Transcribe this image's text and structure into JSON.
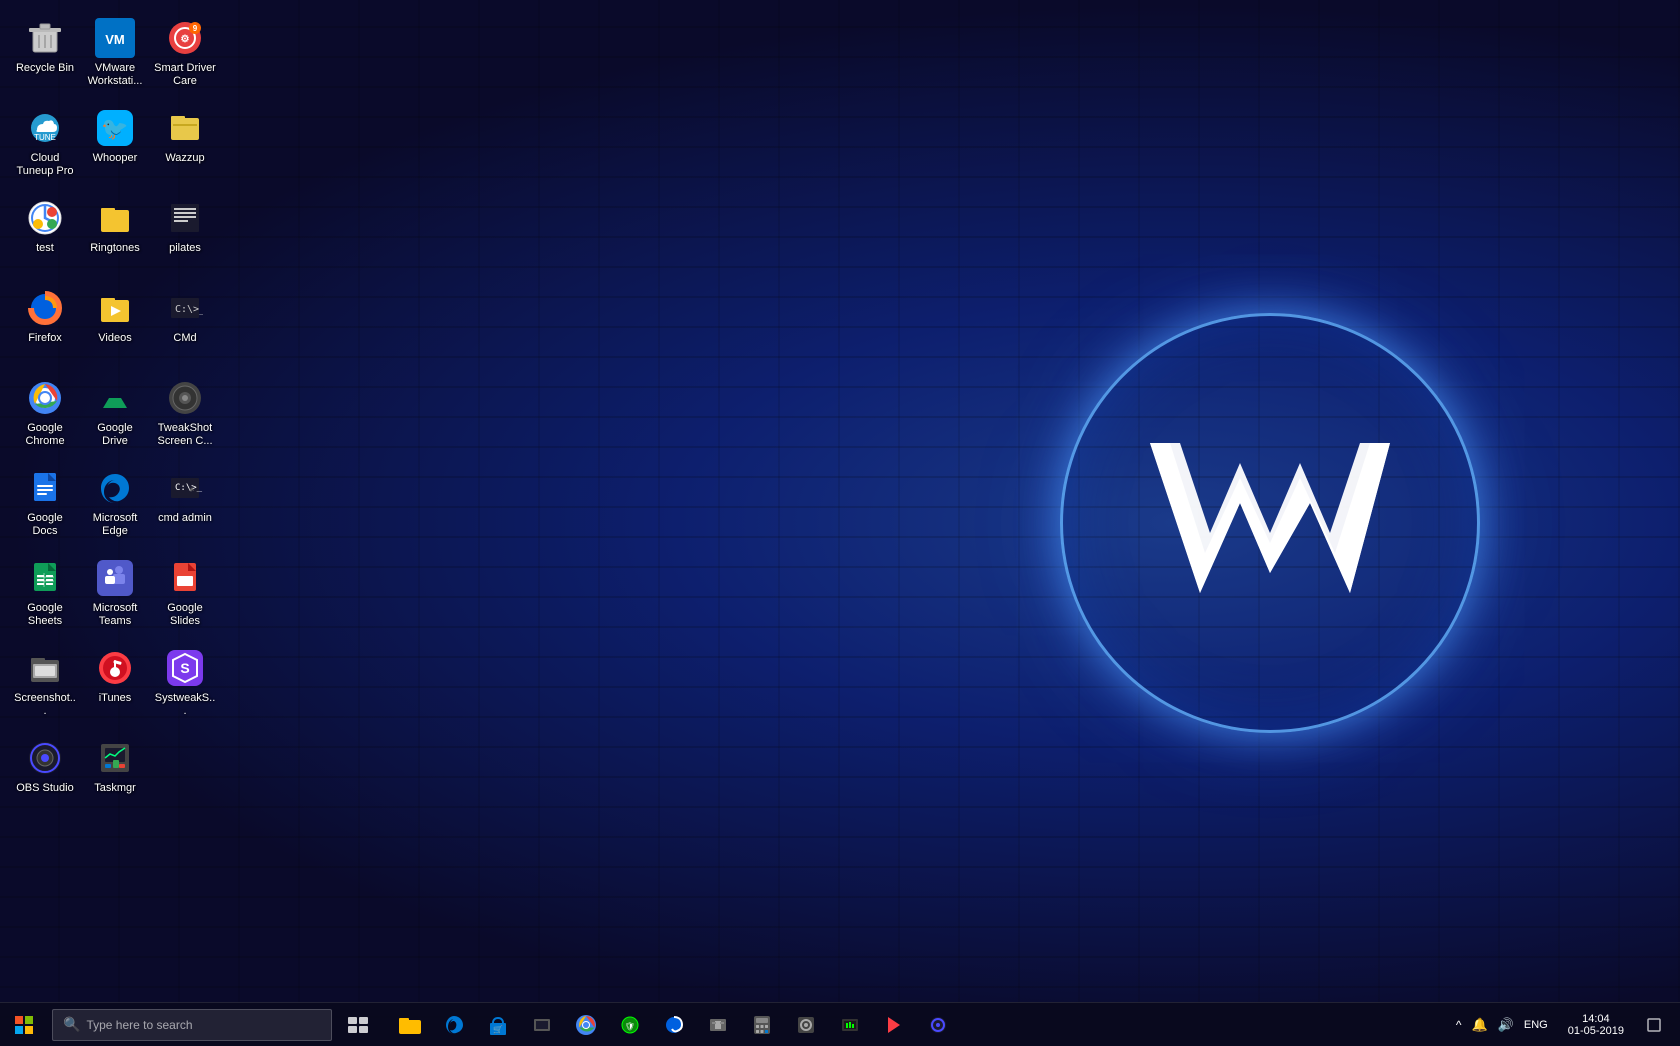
{
  "desktop": {
    "icons": [
      {
        "id": "recycle-bin",
        "label": "Recycle Bin",
        "color": "#aaa",
        "emoji": "🗑️",
        "col": 1,
        "row": 1
      },
      {
        "id": "vmware",
        "label": "VMware Workstati...",
        "color": "#0071c5",
        "emoji": "VM",
        "col": 2,
        "row": 1
      },
      {
        "id": "smart-driver-care",
        "label": "Smart Driver Care",
        "color": "#e84040",
        "emoji": "⚙",
        "col": 3,
        "row": 1
      },
      {
        "id": "cloud-tuneup",
        "label": "Cloud Tuneup Pro",
        "color": "#29abe2",
        "emoji": "☁",
        "col": 1,
        "row": 2
      },
      {
        "id": "whooper",
        "label": "Whooper",
        "color": "#00b0ff",
        "emoji": "🐦",
        "col": 2,
        "row": 2
      },
      {
        "id": "wazzup",
        "label": "Wazzup",
        "color": "#f5c518",
        "emoji": "📁",
        "col": 3,
        "row": 2
      },
      {
        "id": "test",
        "label": "test",
        "color": "#4285f4",
        "emoji": "🌐",
        "col": 1,
        "row": 3
      },
      {
        "id": "ringtones",
        "label": "Ringtones",
        "color": "#f4c430",
        "emoji": "📁",
        "col": 2,
        "row": 3
      },
      {
        "id": "pilates",
        "label": "pilates",
        "color": "#555",
        "emoji": "📄",
        "col": 3,
        "row": 3
      },
      {
        "id": "firefox",
        "label": "Firefox",
        "color": "#ff7139",
        "emoji": "🦊",
        "col": 1,
        "row": 4
      },
      {
        "id": "videos",
        "label": "Videos",
        "color": "#f4c430",
        "emoji": "📁",
        "col": 2,
        "row": 4
      },
      {
        "id": "cmd",
        "label": "CMd",
        "color": "#eee",
        "emoji": "⬛",
        "col": 3,
        "row": 4
      },
      {
        "id": "google-chrome",
        "label": "Google Chrome",
        "color": "#4285f4",
        "emoji": "🌐",
        "col": 1,
        "row": 5
      },
      {
        "id": "google-drive",
        "label": "Google Drive",
        "color": "#fbbc04",
        "emoji": "△",
        "col": 2,
        "row": 5
      },
      {
        "id": "tweakshot",
        "label": "TweakShot Screen C...",
        "color": "#333",
        "emoji": "📷",
        "col": 3,
        "row": 5
      },
      {
        "id": "google-docs",
        "label": "Google Docs",
        "color": "#4285f4",
        "emoji": "📝",
        "col": 1,
        "row": 6
      },
      {
        "id": "microsoft-edge",
        "label": "Microsoft Edge",
        "color": "#0078d4",
        "emoji": "🌐",
        "col": 2,
        "row": 6
      },
      {
        "id": "cmd-admin",
        "label": "cmd admin",
        "color": "#1a1a1a",
        "emoji": "⬛",
        "col": 3,
        "row": 6
      },
      {
        "id": "google-sheets",
        "label": "Google Sheets",
        "color": "#0f9d58",
        "emoji": "📊",
        "col": 1,
        "row": 7
      },
      {
        "id": "microsoft-teams",
        "label": "Microsoft Teams",
        "color": "#5059c9",
        "emoji": "👥",
        "col": 2,
        "row": 7
      },
      {
        "id": "google-slides",
        "label": "Google Slides",
        "color": "#ea4335",
        "emoji": "📑",
        "col": 1,
        "row": 8
      },
      {
        "id": "screenshots",
        "label": "Screenshot...",
        "color": "#aaa",
        "emoji": "📸",
        "col": 2,
        "row": 8
      },
      {
        "id": "itunes",
        "label": "iTunes",
        "color": "#fc3c44",
        "emoji": "🎵",
        "col": 1,
        "row": 9
      },
      {
        "id": "systweak",
        "label": "SystweakS...",
        "color": "#8b5cf6",
        "emoji": "🔧",
        "col": 2,
        "row": 9
      },
      {
        "id": "obs-studio",
        "label": "OBS Studio",
        "color": "#1a1a2e",
        "emoji": "🎬",
        "col": 1,
        "row": 10
      },
      {
        "id": "taskmgr",
        "label": "Taskmgr",
        "color": "#aaa",
        "emoji": "📋",
        "col": 2,
        "row": 10
      }
    ]
  },
  "taskbar": {
    "search_placeholder": "Type here to search",
    "clock_time": "14:04",
    "clock_date": "01-05-2019",
    "language": "ENG",
    "apps": [
      {
        "id": "task-view",
        "emoji": "⊞"
      },
      {
        "id": "file-explorer",
        "emoji": "📁"
      },
      {
        "id": "edge-tb",
        "emoji": "e"
      },
      {
        "id": "store",
        "emoji": "🛍"
      },
      {
        "id": "unknown1",
        "emoji": "🖥"
      },
      {
        "id": "chrome-tb",
        "emoji": "🌐"
      },
      {
        "id": "unknown2",
        "emoji": "🛡"
      },
      {
        "id": "unknown3",
        "emoji": "🌐"
      },
      {
        "id": "edge2",
        "emoji": "e"
      },
      {
        "id": "calculator",
        "emoji": "🔢"
      },
      {
        "id": "unknown4",
        "emoji": "🖥"
      },
      {
        "id": "unknown5",
        "emoji": "🖥"
      },
      {
        "id": "media",
        "emoji": "🎬"
      },
      {
        "id": "unknown6",
        "emoji": "🔵"
      }
    ]
  },
  "logo": {
    "letter": "W"
  }
}
